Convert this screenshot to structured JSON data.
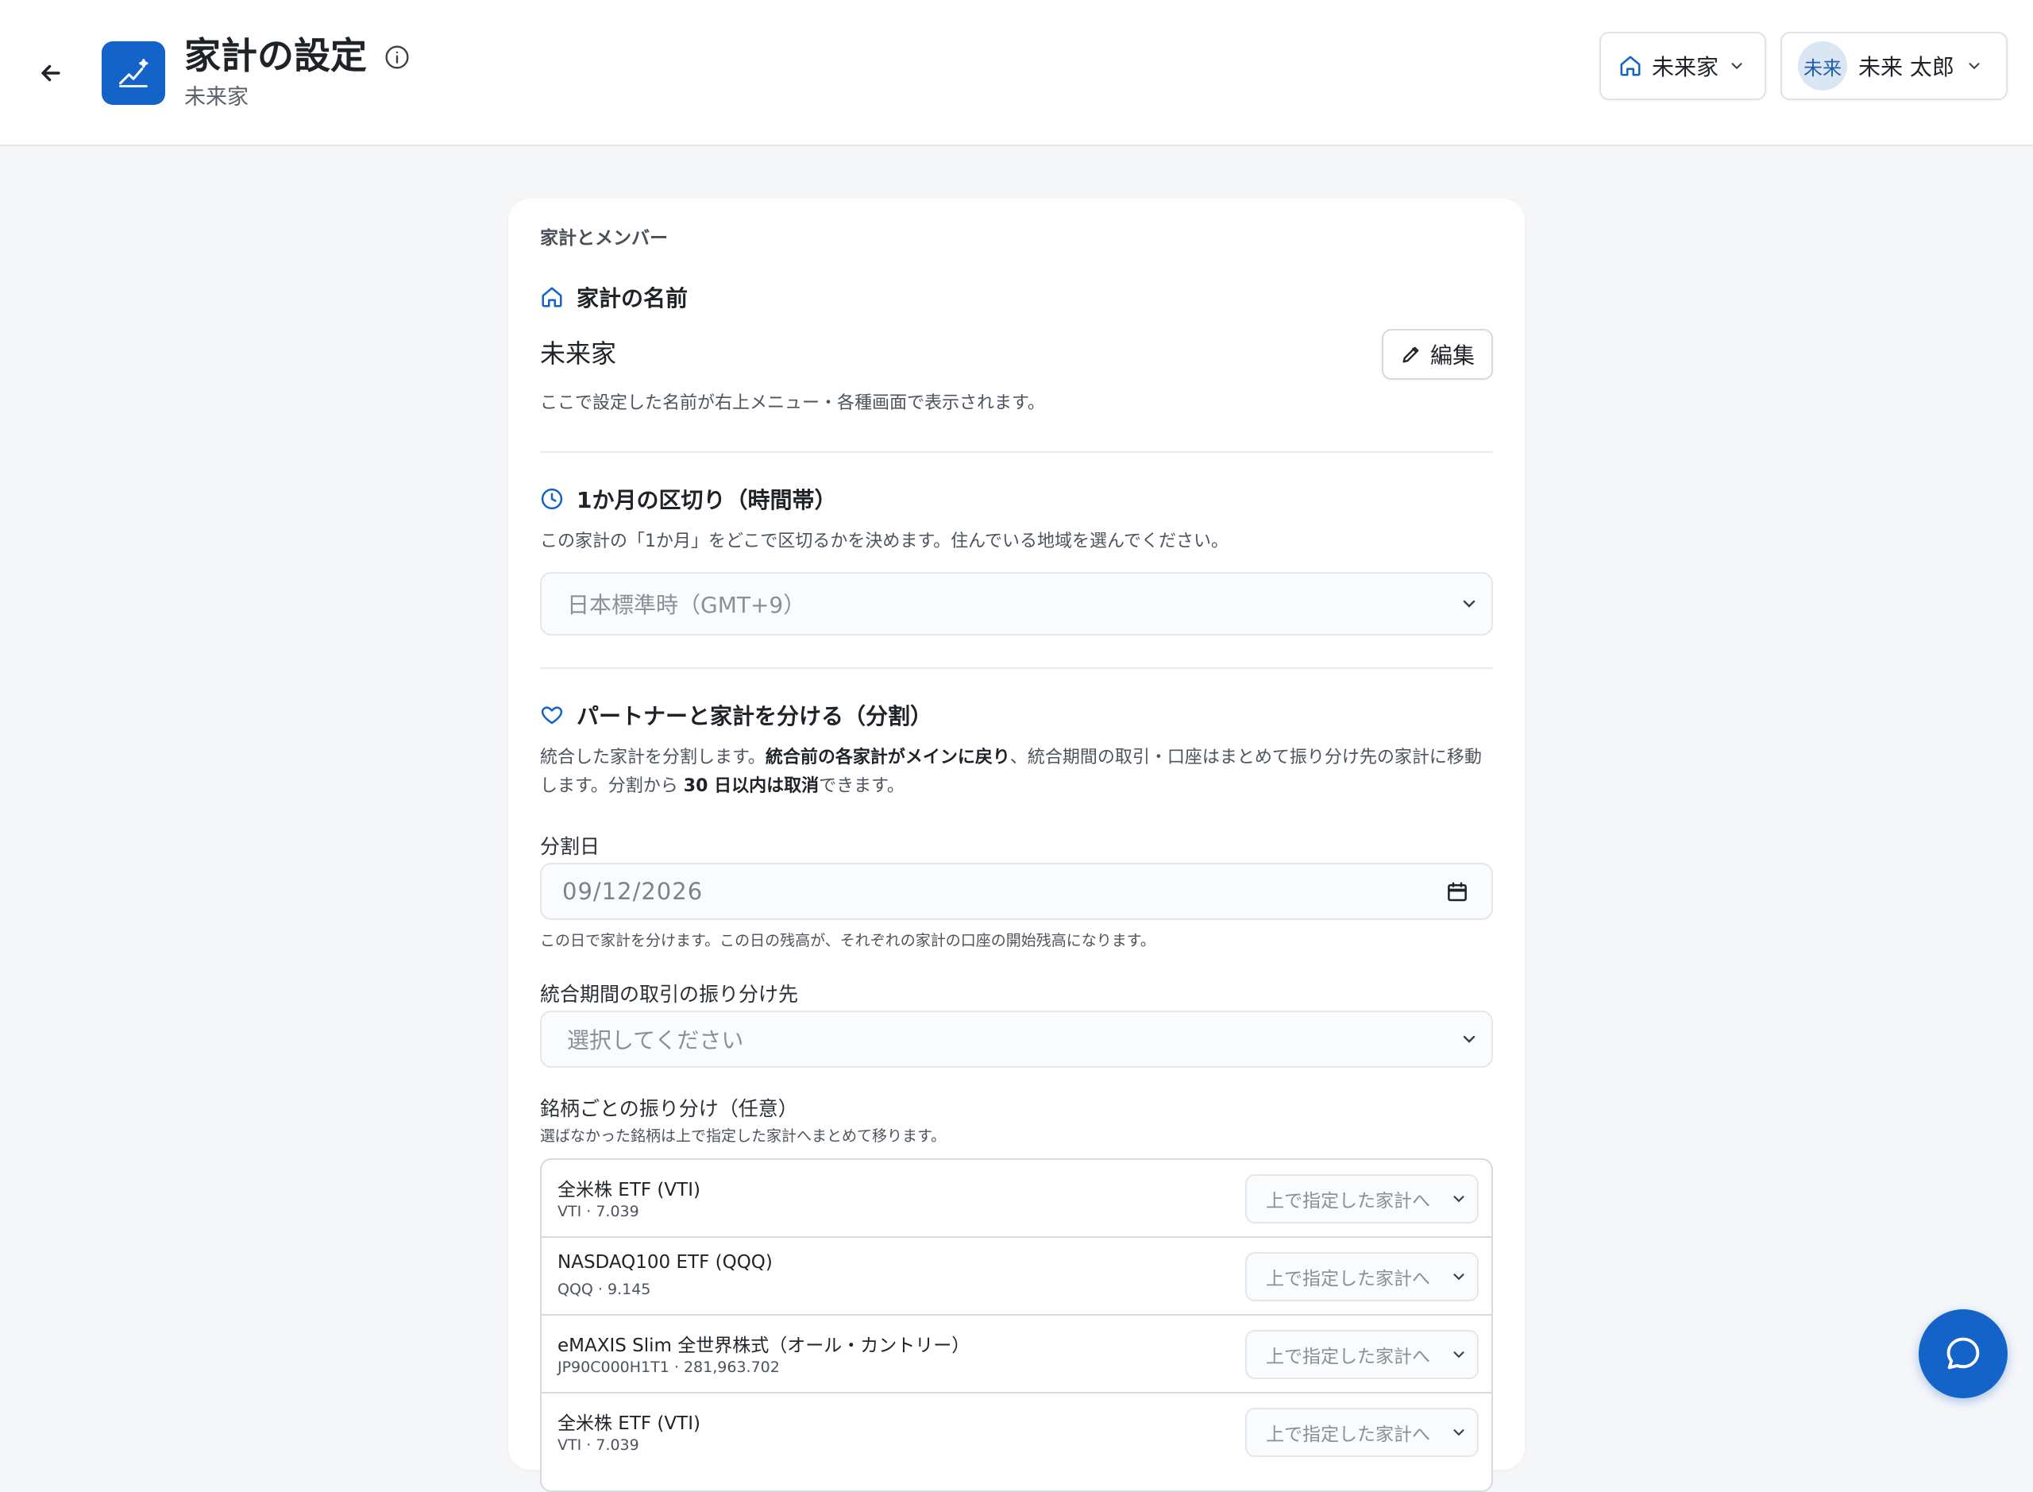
{
  "header": {
    "title": "家計の設定",
    "subtitle": "未来家",
    "household_switch": "未来家",
    "user": {
      "avatar_text": "未来",
      "name": "未来 太郎"
    }
  },
  "colors": {
    "accent": "#1463c9",
    "page_bg": "#f5f6f8",
    "avatar_bg": "#dbe6f4"
  },
  "section": {
    "label": "家計とメンバー",
    "name_block": {
      "heading": "家計の名前",
      "value": "未来家",
      "edit_label": "編集",
      "help": "ここで設定した名前が右上メニュー・各種画面で表示されます。"
    },
    "month_block": {
      "heading": "1か月の区切り（時間帯）",
      "help": "この家計の「1か月」をどこで区切るかを決めます。住んでいる地域を選んでください。",
      "timezone_value": "日本標準時（GMT+9）"
    },
    "split_block": {
      "heading": "パートナーと家計を分ける（分割）",
      "desc_1": "統合した家計を分割します。",
      "desc_2": "統合前の各家計がメインに戻り",
      "desc_3": "、統合期間の取引・口座はまとめて振り分け先の家計に移動",
      "desc_4": "します。分割から ",
      "desc_5": "30 日以内は取消",
      "desc_6": "できます。",
      "date_label": "分割日",
      "date_value": "09/12/2026",
      "date_help": "この日で家計を分けます。この日の残高が、それぞれの家計の口座の開始残高になります。",
      "dest_label": "統合期間の取引の振り分け先",
      "dest_placeholder": "選択してください",
      "per_ticker_label": "銘柄ごとの振り分け（任意）",
      "per_ticker_help": "選ばなかった銘柄は上で指定した家計へまとめて移ります。",
      "tickers": [
        {
          "name": "全米株 ETF (VTI)",
          "sub": "VTI · 7.039",
          "dest": "上で指定した家計へ"
        },
        {
          "name": "NASDAQ100 ETF (QQQ)",
          "sub": "QQQ · 9.145",
          "dest": "上で指定した家計へ"
        },
        {
          "name": "eMAXIS Slim 全世界株式（オール・カントリー）",
          "sub": "JP90C000H1T1 · 281,963.702",
          "dest": "上で指定した家計へ"
        },
        {
          "name": "全米株 ETF (VTI)",
          "sub": "VTI · 7.039",
          "dest": "上で指定した家計へ"
        }
      ]
    }
  },
  "icons": {
    "back": "arrow-left-icon",
    "logo": "chart-sparkle-icon",
    "info": "info-icon",
    "home": "home-icon",
    "chevron": "chevron-down-icon",
    "pencil": "pencil-icon",
    "clock": "clock-icon",
    "heart": "heart-icon",
    "calendar": "calendar-icon",
    "chat": "chat-bubble-icon"
  }
}
